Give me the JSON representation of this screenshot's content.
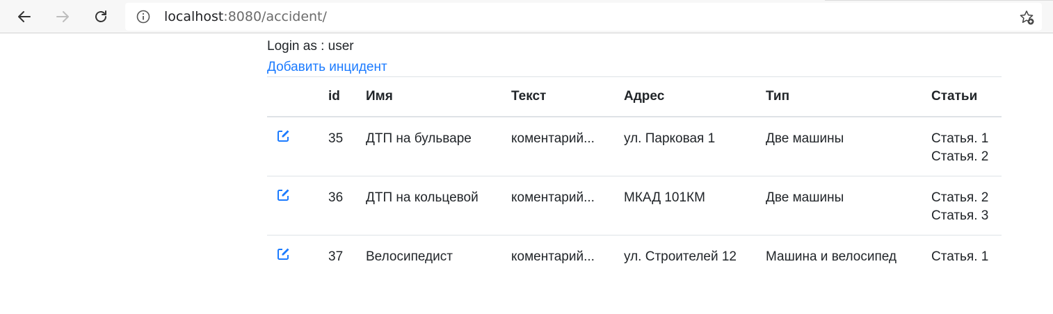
{
  "browser": {
    "url_host": "localhost",
    "url_rest": ":8080/accident/"
  },
  "page": {
    "login_text": "Login as : user",
    "add_link": "Добавить инцидент"
  },
  "table": {
    "headers": {
      "edit": "",
      "id": "id",
      "name": "Имя",
      "text": "Текст",
      "address": "Адрес",
      "type": "Тип",
      "articles": "Статьи"
    },
    "rows": [
      {
        "id": "35",
        "name": "ДТП на бульваре",
        "text": "коментарий...",
        "address": "ул. Парковая 1",
        "type": "Две машины",
        "articles": [
          "Статья. 1",
          "Статья. 2"
        ]
      },
      {
        "id": "36",
        "name": "ДТП на кольцевой",
        "text": "коментарий...",
        "address": "МКАД 101КМ",
        "type": "Две машины",
        "articles": [
          "Статья. 2",
          "Статья. 3"
        ]
      },
      {
        "id": "37",
        "name": "Велосипедист",
        "text": "коментарий...",
        "address": "ул. Строителей 12",
        "type": "Машина и велосипед",
        "articles": [
          "Статья. 1"
        ]
      }
    ]
  },
  "icons": {
    "back": "arrow-left-icon",
    "forward": "arrow-right-icon",
    "reload": "reload-icon",
    "info": "info-icon",
    "star": "star-add-icon",
    "edit": "edit-icon"
  },
  "colors": {
    "link": "#1b7bff",
    "edit_icon": "#1b7bff",
    "border": "#dee2e6"
  }
}
